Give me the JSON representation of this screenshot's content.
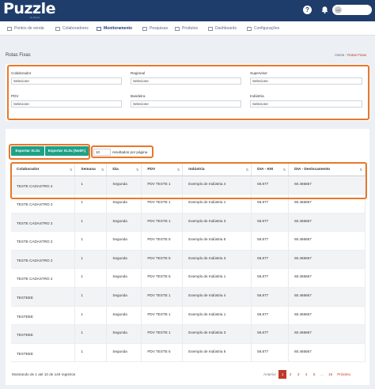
{
  "app": {
    "logo": "Puzzle",
    "logo_sub": "by Nexus"
  },
  "topbar": {
    "help_icon": "?",
    "user_initials": "ua"
  },
  "menu": [
    {
      "label": "Pontos de venda",
      "icon": "shop-icon"
    },
    {
      "label": "Colaboradores",
      "icon": "users-icon"
    },
    {
      "label": "Monitoramento",
      "icon": "clipboard-icon",
      "active": true
    },
    {
      "label": "Pesquisas",
      "icon": "survey-icon"
    },
    {
      "label": "Produtos",
      "icon": "box-icon"
    },
    {
      "label": "Dashboards",
      "icon": "chart-icon"
    },
    {
      "label": "Configurações",
      "icon": "gear-icon"
    }
  ],
  "page": {
    "title": "Rotas Fixas",
    "breadcrumb_home": "Home",
    "breadcrumb_sep": "/",
    "breadcrumb_current": "Rotas Fixas"
  },
  "filters": [
    {
      "label": "Colaborador",
      "value": "Selecione"
    },
    {
      "label": "Regional",
      "value": "Selecione"
    },
    {
      "label": "Supervisor",
      "value": "Selecione"
    },
    {
      "label": "PDV",
      "value": "Selecione"
    },
    {
      "label": "Bandeira",
      "value": "Selecione"
    },
    {
      "label": "Indústria",
      "value": "Selecione"
    }
  ],
  "actions": {
    "export_xls": "Exportar XLSx",
    "export_xls_notif": "Exportar XLSx (NotiF.)",
    "page_length": "10",
    "page_length_label": "resultados por página"
  },
  "table": {
    "columns": [
      "Colaborador",
      "Semana",
      "Dia",
      "PDV",
      "Indústria",
      "DIA - KM",
      "DIA - Deslocamento"
    ],
    "rows": [
      [
        "TESTE CADASTRO 2",
        "1",
        "Segunda",
        "PDV TESTE 1",
        "Exemplo de Indústria 4",
        "56.877",
        "60.466667"
      ],
      [
        "TESTE CADASTRO 2",
        "1",
        "Segunda",
        "PDV TESTE 1",
        "Exemplo de Indústria 1",
        "56.877",
        "60.466667"
      ],
      [
        "TESTE CADASTRO 2",
        "1",
        "Segunda",
        "PDV TESTE 1",
        "Exemplo de Indústria 3",
        "56.877",
        "60.466667"
      ],
      [
        "TESTE CADASTRO 2",
        "1",
        "Segunda",
        "PDV TESTE 5",
        "Exemplo de Indústria 5",
        "56.877",
        "60.466667"
      ],
      [
        "TESTE CADASTRO 2",
        "1",
        "Segunda",
        "PDV TESTE 5",
        "Exemplo de Indústria 3",
        "56.877",
        "60.466667"
      ],
      [
        "TESTE CADASTRO 2",
        "1",
        "Segunda",
        "PDV TESTE 5",
        "Exemplo de Indústria 1",
        "56.877",
        "60.466667"
      ],
      [
        "TESTEEE",
        "1",
        "Segunda",
        "PDV TESTE 1",
        "Exemplo de Indústria 4",
        "56.877",
        "60.466667"
      ],
      [
        "TESTEEE",
        "1",
        "Segunda",
        "PDV TESTE 1",
        "Exemplo de Indústria 1",
        "56.877",
        "60.466667"
      ],
      [
        "TESTEEE",
        "1",
        "Segunda",
        "PDV TESTE 1",
        "Exemplo de Indústria 3",
        "56.877",
        "60.466667"
      ],
      [
        "TESTEEE",
        "1",
        "Segunda",
        "PDV TESTE 5",
        "Exemplo de Indústria 5",
        "56.877",
        "60.466667"
      ]
    ]
  },
  "footer": {
    "info": "Mostrando de 1 até 10 de 149 registros",
    "pager": [
      "Anterior",
      "1",
      "2",
      "3",
      "4",
      "5",
      "...",
      "15",
      "Próximo"
    ],
    "current_page": "1"
  },
  "colors": {
    "topbar": "#1f3d6b",
    "highlight": "#e8782a",
    "button": "#1fa187",
    "accent": "#c0392b"
  }
}
